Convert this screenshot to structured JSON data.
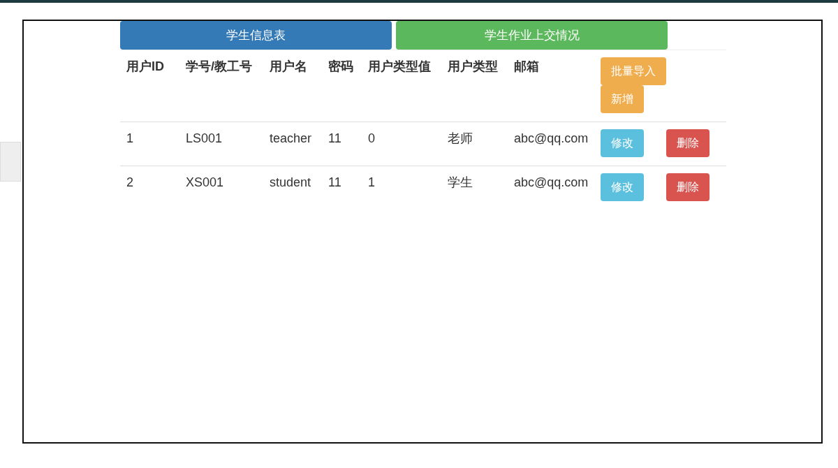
{
  "tabs": [
    {
      "label": "学生信息表",
      "color": "#337ab7"
    },
    {
      "label": "学生作业上交情况",
      "color": "#5cb85c"
    }
  ],
  "table": {
    "columns": [
      "用户ID",
      "学号/教工号",
      "用户名",
      "密码",
      "用户类型值",
      "用户类型",
      "邮箱"
    ],
    "header_buttons": [
      {
        "label": "批量导入",
        "kind": "warning"
      },
      {
        "label": "新增",
        "kind": "warning"
      }
    ],
    "rows": [
      {
        "cells": [
          "1",
          "LS001",
          "teacher",
          "11",
          "0",
          "老师",
          "abc@qq.com"
        ],
        "buttons": [
          {
            "label": "修改",
            "kind": "info"
          },
          {
            "label": "删除",
            "kind": "danger"
          }
        ]
      },
      {
        "cells": [
          "2",
          "XS001",
          "student",
          "11",
          "1",
          "学生",
          "abc@qq.com"
        ],
        "buttons": [
          {
            "label": "修改",
            "kind": "info"
          },
          {
            "label": "删除",
            "kind": "danger"
          }
        ]
      }
    ]
  }
}
